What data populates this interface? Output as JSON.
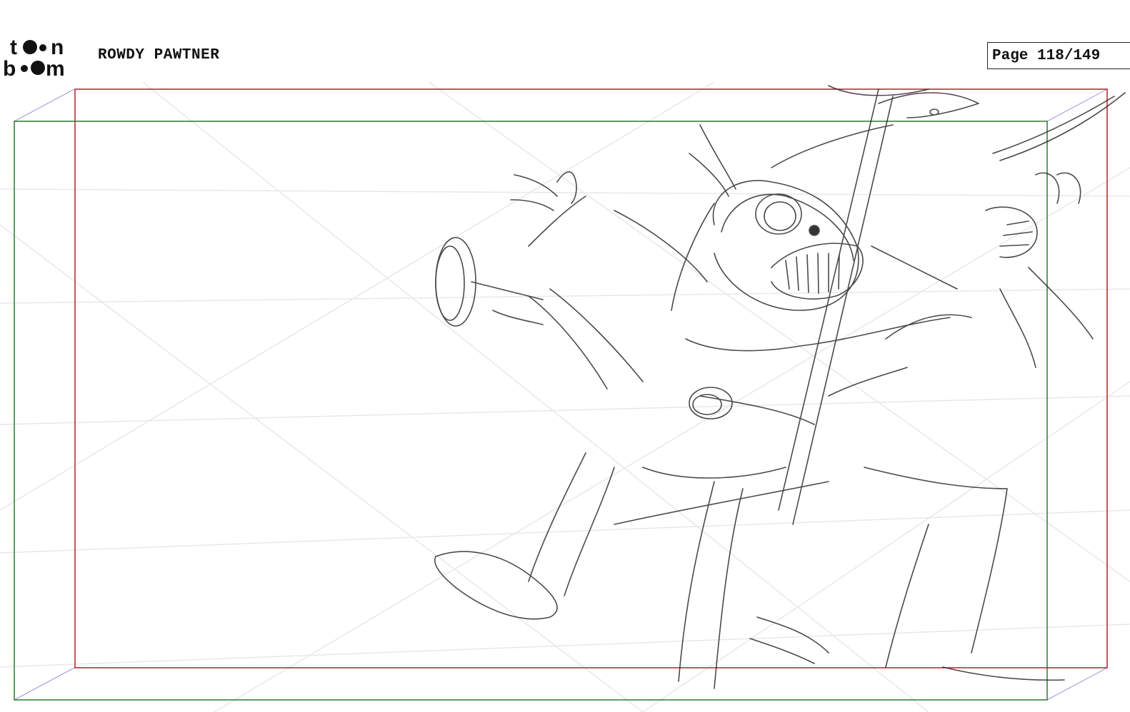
{
  "header": {
    "logo_text": "toon boom",
    "project_title": "ROWDY PAWTNER",
    "page_counter": "Page 118/149"
  },
  "panel": {
    "frame_colors": {
      "camera_field": "#b42025",
      "safe_field": "#2a7a2a",
      "perspective_guides": "#8a8ad8",
      "grid": "#e6e6ea",
      "sketch": "#2b2b2b"
    }
  }
}
